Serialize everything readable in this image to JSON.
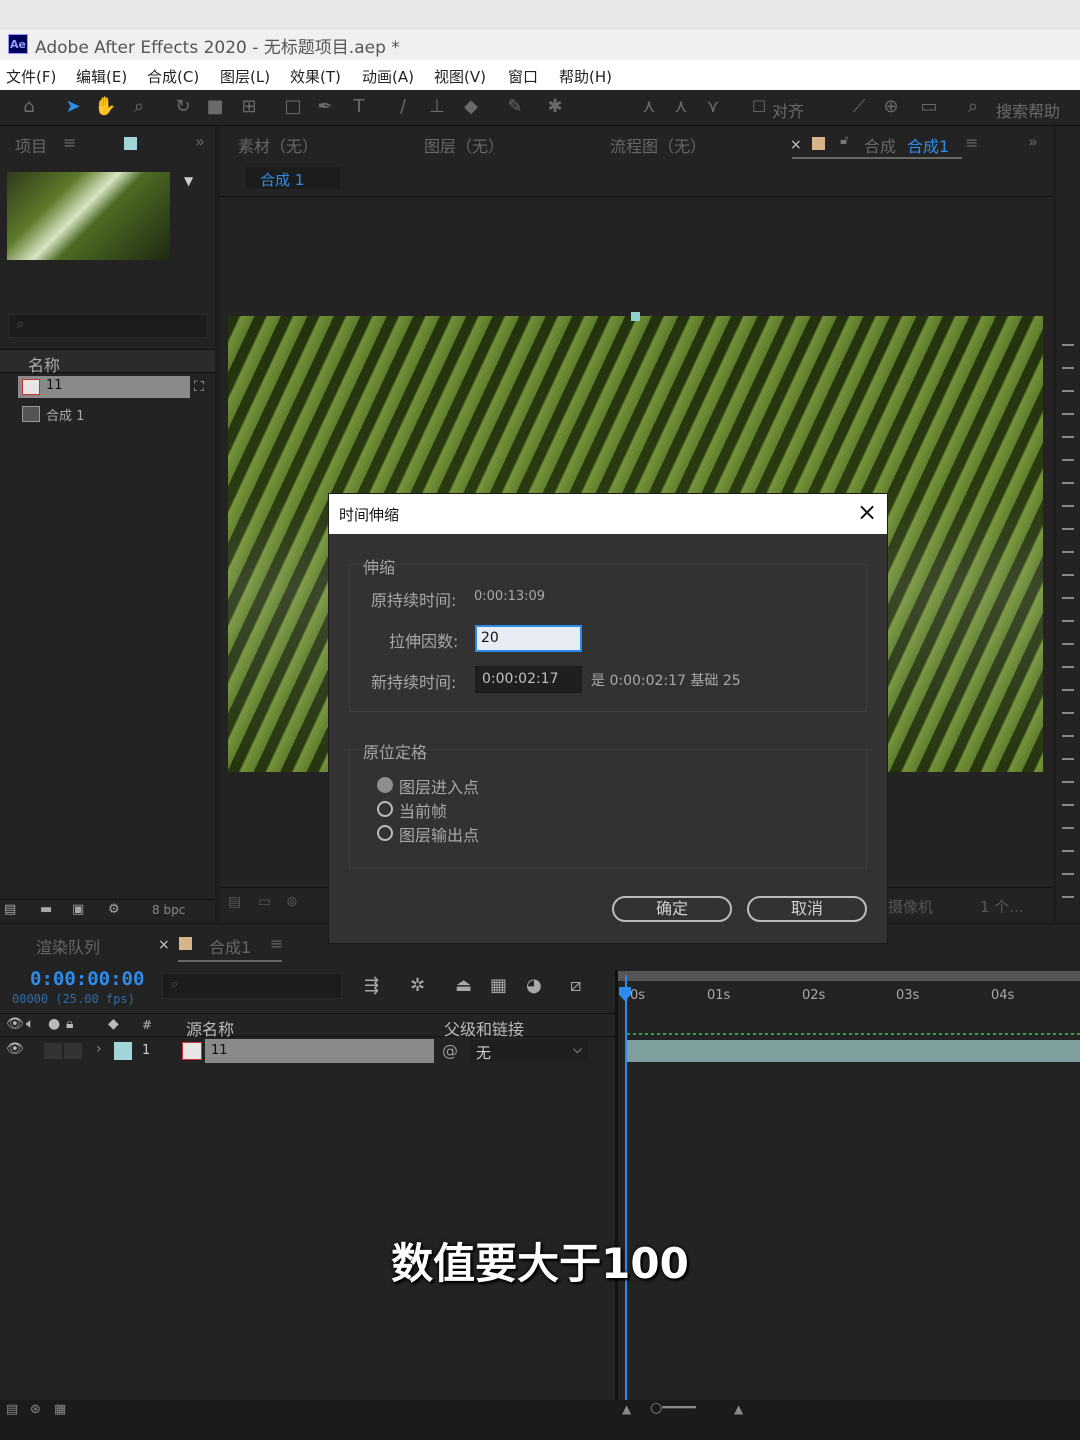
{
  "window": {
    "app_logo": "Ae",
    "title": "Adobe After Effects 2020 - 无标题项目.aep *"
  },
  "menu": [
    "文件(F)",
    "编辑(E)",
    "合成(C)",
    "图层(L)",
    "效果(T)",
    "动画(A)",
    "视图(V)",
    "窗口",
    "帮助(H)"
  ],
  "toolbar": {
    "align_label": "对齐",
    "search_help": "搜索帮助"
  },
  "project_panel": {
    "tab_label": "项目",
    "column_name": "名称",
    "items": [
      {
        "name": "11",
        "type": "footage"
      },
      {
        "name": "合成 1",
        "type": "composition"
      }
    ],
    "bpc": "8 bpc"
  },
  "viewer_tabs": {
    "footage": "素材（无）",
    "layer": "图层（无）",
    "flowchart": "流程图（无）",
    "comp_prefix": "合成",
    "comp_name": "合成1",
    "breadcrumb": "合成 1"
  },
  "viewer_footer": {
    "camera": "摄像机",
    "views": "1 个..."
  },
  "dialog": {
    "title": "时间伸缩",
    "stretch_group": "伸缩",
    "original_duration_label": "原持续时间:",
    "original_duration_value": "0:00:13:09",
    "stretch_factor_label": "拉伸因数:",
    "stretch_factor_value": "20",
    "new_duration_label": "新持续时间:",
    "new_duration_value": "0:00:02:17",
    "new_duration_equiv": "是 0:00:02:17 基础 25",
    "hold_group": "原位定格",
    "options": [
      {
        "label": "图层进入点",
        "selected": true
      },
      {
        "label": "当前帧",
        "selected": false
      },
      {
        "label": "图层输出点",
        "selected": false
      }
    ],
    "ok_label": "确定",
    "cancel_label": "取消"
  },
  "timeline": {
    "render_queue_tab": "渲染队列",
    "comp_tab": "合成1",
    "timecode": "0:00:00:00",
    "frame_info": "00000 (25.00 fps)",
    "col_hash": "#",
    "col_source_name": "源名称",
    "col_parent": "父级和链接",
    "layers": [
      {
        "index": "1",
        "name": "11",
        "parent": "无"
      }
    ],
    "ruler": [
      "0s",
      "01s",
      "02s",
      "03s",
      "04s"
    ]
  },
  "subtitle": "数值要大于100",
  "colors": {
    "accent_blue": "#2d8ceb",
    "panel_bg": "#232323",
    "dialog_bg": "#323232",
    "label_color": "#a2d5d8"
  }
}
